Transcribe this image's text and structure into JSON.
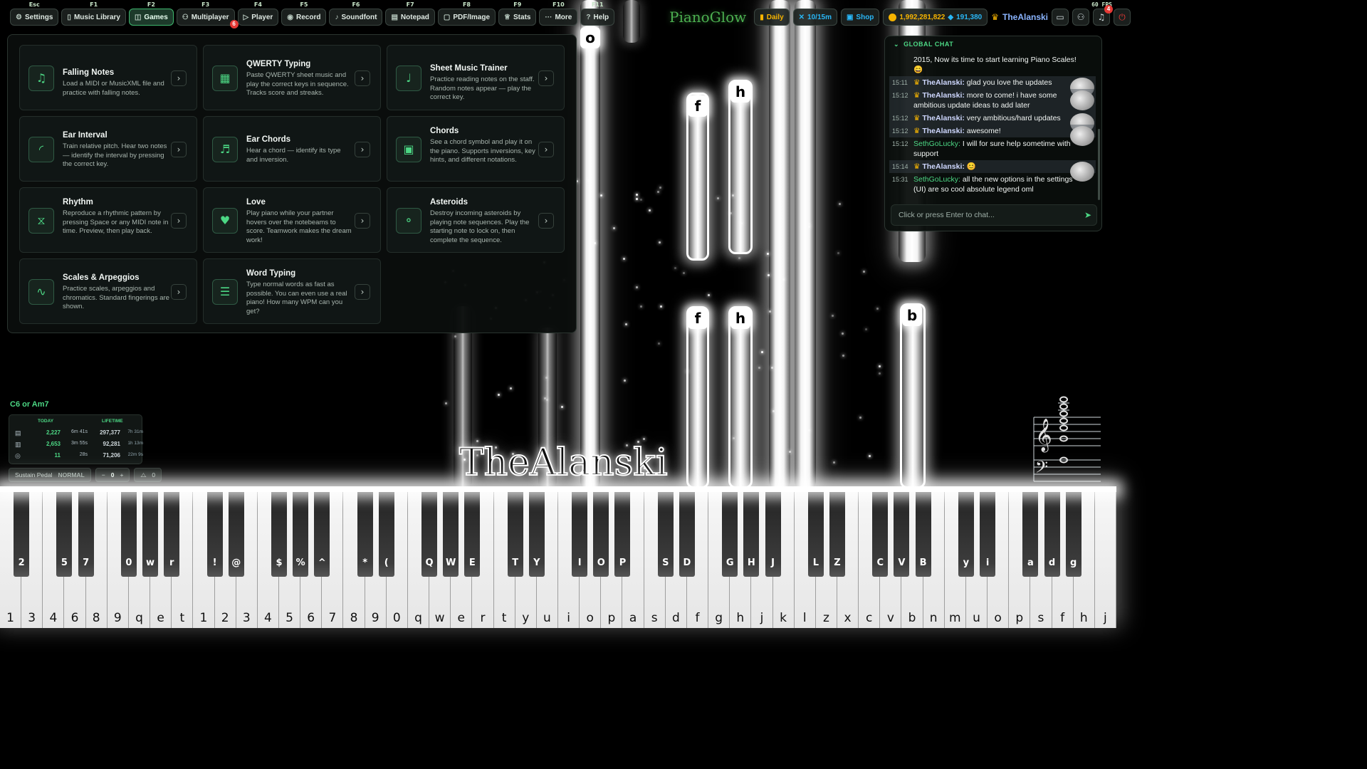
{
  "topbar": {
    "items": [
      {
        "key": "Esc",
        "label": "Settings",
        "icon": "gear-icon",
        "glyph": "⚙"
      },
      {
        "key": "F1",
        "label": "Music Library",
        "icon": "book-icon",
        "glyph": "▯"
      },
      {
        "key": "F2",
        "label": "Games",
        "icon": "gamepad-icon",
        "glyph": "◫",
        "active": true
      },
      {
        "key": "F3",
        "label": "Multiplayer",
        "icon": "users-icon",
        "glyph": "⚇",
        "badge": "6"
      },
      {
        "key": "F4",
        "label": "Player",
        "icon": "play-icon",
        "glyph": "▷"
      },
      {
        "key": "F5",
        "label": "Record",
        "icon": "record-icon",
        "glyph": "◉"
      },
      {
        "key": "F6",
        "label": "Soundfont",
        "icon": "music-note-icon",
        "glyph": "♪"
      },
      {
        "key": "F7",
        "label": "Notepad",
        "icon": "notepad-icon",
        "glyph": "▤"
      },
      {
        "key": "F8",
        "label": "PDF/Image",
        "icon": "file-icon",
        "glyph": "▢"
      },
      {
        "key": "F9",
        "label": "Stats",
        "icon": "trophy-icon",
        "glyph": "♕"
      },
      {
        "key": "F10",
        "label": "More",
        "icon": "more-icon",
        "glyph": "···"
      },
      {
        "key": "F11",
        "label": "Help",
        "icon": "help-icon",
        "glyph": "?"
      }
    ],
    "fps": "60 FPS"
  },
  "header_right": {
    "logo": "PianoGlow",
    "daily": "Daily",
    "progress": "10/15m",
    "shop": "Shop",
    "coins": "1,992,281,822",
    "gems": "191,380",
    "username": "TheAlanski",
    "notifications": "4"
  },
  "games": [
    {
      "title": "Falling Notes",
      "desc": "Load a MIDI or MusicXML file and practice with falling notes.",
      "icon": "falling-notes-icon",
      "glyph": "♫"
    },
    {
      "title": "QWERTY Typing",
      "desc": "Paste QWERTY sheet music and play the correct keys in sequence. Tracks score and streaks.",
      "icon": "keyboard-icon",
      "glyph": "▦"
    },
    {
      "title": "Sheet Music Trainer",
      "desc": "Practice reading notes on the staff. Random notes appear — play the correct key.",
      "icon": "sheet-music-icon",
      "glyph": "♩"
    },
    {
      "title": "Ear Interval",
      "desc": "Train relative pitch. Hear two notes — identify the interval by pressing the correct key.",
      "icon": "ear-icon",
      "glyph": "◜"
    },
    {
      "title": "Ear Chords",
      "desc": "Hear a chord — identify its type and inversion.",
      "icon": "ear-chords-icon",
      "glyph": "♬"
    },
    {
      "title": "Chords",
      "desc": "See a chord symbol and play it on the piano. Supports inversions, key hints, and different notations.",
      "icon": "chords-icon",
      "glyph": "▣"
    },
    {
      "title": "Rhythm",
      "desc": "Reproduce a rhythmic pattern by pressing Space or any MIDI note in time. Preview, then play back.",
      "icon": "metronome-icon",
      "glyph": "⧖"
    },
    {
      "title": "Love",
      "desc": "Play piano while your partner hovers over the notebeams to score. Teamwork makes the dream work!",
      "icon": "heart-icon",
      "glyph": "♥"
    },
    {
      "title": "Asteroids",
      "desc": "Destroy incoming asteroids by playing note sequences. Play the starting note to lock on, then complete the sequence.",
      "icon": "asteroids-icon",
      "glyph": "⚬"
    },
    {
      "title": "Scales & Arpeggios",
      "desc": "Practice scales, arpeggios and chromatics. Standard fingerings are shown.",
      "icon": "scales-icon",
      "glyph": "∿"
    },
    {
      "title": "Word Typing",
      "desc": "Type normal words as fast as possible. You can even use a real piano! How many WPM can you get?",
      "icon": "word-typing-icon",
      "glyph": "☰"
    }
  ],
  "chat": {
    "title": "GLOBAL CHAT",
    "messages": [
      {
        "time": "",
        "user": "",
        "text": "2015, Now its time to start learning Piano Scales! 😄"
      },
      {
        "time": "15:11",
        "user": "TheAlanski:",
        "text": " glad you love the updates",
        "kind": "gold"
      },
      {
        "time": "15:12",
        "user": "TheAlanski:",
        "text": " more to come! i have some ambitious update ideas to add later",
        "kind": "gold"
      },
      {
        "time": "15:12",
        "user": "TheAlanski:",
        "text": " very ambitious/hard updates",
        "kind": "gold"
      },
      {
        "time": "15:12",
        "user": "TheAlanski:",
        "text": " awesome!",
        "kind": "gold"
      },
      {
        "time": "15:12",
        "user": "SethGoLucky:",
        "text": " I will for sure help sometime with support",
        "kind": "green"
      },
      {
        "time": "15:14",
        "user": "TheAlanski:",
        "text": " 😊",
        "kind": "gold"
      },
      {
        "time": "15:31",
        "user": "SethGoLucky:",
        "text": " all the new options in the settings (UI) are so cool absolute legend oml",
        "kind": "green"
      }
    ],
    "input_placeholder": "Click or press Enter to chat..."
  },
  "stats": {
    "chord": "C6 or Am7",
    "today_label": "TODAY",
    "lifetime_label": "LIFETIME",
    "rows": [
      {
        "icon": "keyboard-icon",
        "today": "2,227",
        "today_time": "6m 41s",
        "lifetime": "297,377",
        "lifetime_time": "7h 31m"
      },
      {
        "icon": "piano-icon",
        "today": "2,653",
        "today_time": "3m 55s",
        "lifetime": "92,281",
        "lifetime_time": "1h 13m"
      },
      {
        "icon": "target-icon",
        "today": "11",
        "today_time": "28s",
        "lifetime": "71,206",
        "lifetime_time": "22m 9s"
      }
    ]
  },
  "controls": {
    "pedal": "Sustain Pedal",
    "mode": "NORMAL",
    "transpose": "0",
    "metronome": "0"
  },
  "player_name": "TheAlanski",
  "falling_letters": [
    "o",
    "f",
    "h",
    "f",
    "h",
    "b"
  ],
  "keyboard": {
    "white": [
      "1",
      "3",
      "4",
      "6",
      "8",
      "9",
      "q",
      "e",
      "t",
      "1",
      "2",
      "3",
      "4",
      "5",
      "6",
      "7",
      "8",
      "9",
      "0",
      "q",
      "w",
      "e",
      "r",
      "t",
      "y",
      "u",
      "i",
      "o",
      "p",
      "a",
      "s",
      "d",
      "f",
      "g",
      "h",
      "j",
      "k",
      "l",
      "z",
      "x",
      "c",
      "v",
      "b",
      "n",
      "m",
      "u",
      "o",
      "p",
      "s",
      "f",
      "h",
      "j"
    ],
    "black": [
      "2",
      "5",
      "7",
      "0",
      "w",
      "r",
      "!",
      "@",
      "$",
      "%",
      "^",
      "*",
      "(",
      "Q",
      "W",
      "E",
      "T",
      "Y",
      "I",
      "O",
      "P",
      "S",
      "D",
      "G",
      "H",
      "J",
      "L",
      "Z",
      "C",
      "V",
      "B",
      "y",
      "i",
      "a",
      "d",
      "g"
    ]
  },
  "colors": {
    "accent": "#4cd784",
    "panel": "#0a0e0c",
    "card": "#101615"
  }
}
